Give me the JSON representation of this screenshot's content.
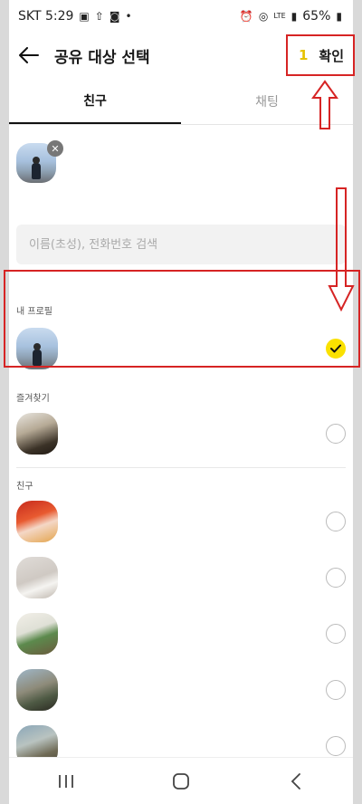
{
  "status_bar": {
    "carrier_time": "SKT 5:29",
    "network": "LTE",
    "battery": "65%"
  },
  "header": {
    "title": "공유 대상 선택",
    "confirm_count": "1",
    "confirm_label": "확인"
  },
  "tabs": [
    {
      "label": "친구",
      "active": true
    },
    {
      "label": "채팅",
      "active": false
    }
  ],
  "selected_chip": {
    "name": ""
  },
  "search": {
    "placeholder": "이름(초성), 전화번호 검색",
    "value": ""
  },
  "sections": {
    "my_profile": "내 프로필",
    "favorites": "즐겨찾기",
    "friends": "친구"
  },
  "my_profile": {
    "name": "",
    "checked": true
  },
  "favorites": [
    {
      "name": "",
      "checked": false
    }
  ],
  "friends": [
    {
      "name": "",
      "checked": false
    },
    {
      "name": "",
      "checked": false
    },
    {
      "name": "",
      "checked": false
    },
    {
      "name": "",
      "checked": false
    },
    {
      "name": "",
      "checked": false
    }
  ],
  "colors": {
    "accent_yellow": "#fae100",
    "annotation_red": "#d62424"
  }
}
